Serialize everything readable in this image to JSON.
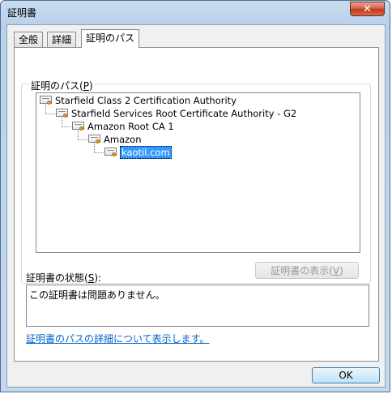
{
  "window": {
    "title": "証明書",
    "close_label": "✕"
  },
  "tabs": [
    {
      "label": "全般"
    },
    {
      "label": "詳細"
    },
    {
      "label": "証明のパス"
    }
  ],
  "path_group": {
    "label_prefix": "証明のパス(",
    "label_key": "P",
    "label_suffix": ")"
  },
  "tree": [
    {
      "label": "Starfield Class 2 Certification Authority"
    },
    {
      "label": "Starfield Services Root Certificate Authority - G2"
    },
    {
      "label": "Amazon Root CA 1"
    },
    {
      "label": "Amazon"
    },
    {
      "label": "kaotil.com",
      "selected": true
    }
  ],
  "view_cert_button": {
    "label_prefix": "証明書の表示(",
    "label_key": "V",
    "label_suffix": ")"
  },
  "status": {
    "label_prefix": "証明書の状態(",
    "label_key": "S",
    "label_suffix": "):",
    "text": "この証明書は問題ありません。"
  },
  "details_link": "証明書のパスの詳細について表示します。",
  "ok_button": "OK"
}
